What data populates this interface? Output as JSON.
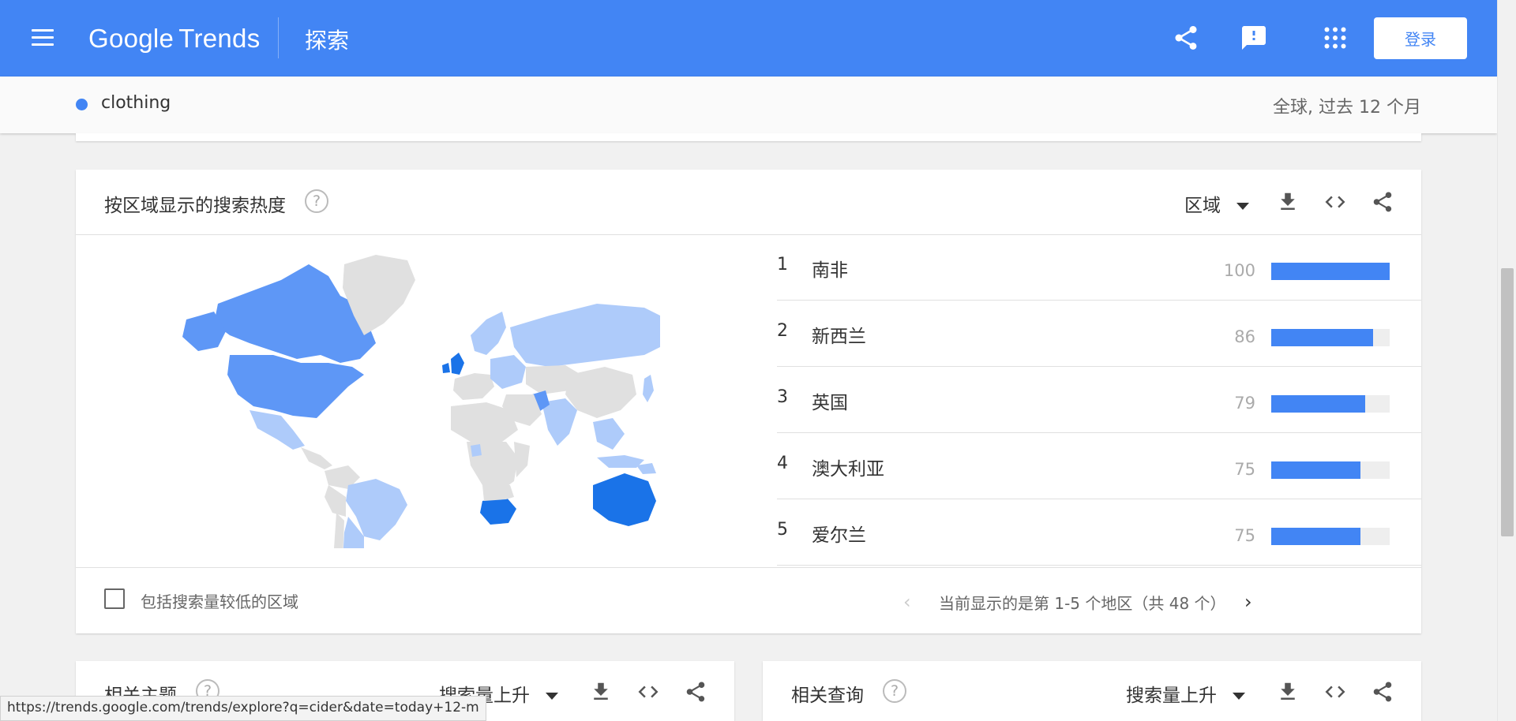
{
  "header": {
    "logo_google": "Google",
    "logo_trends": "Trends",
    "section": "探索",
    "login": "登录",
    "icons": [
      "menu-icon",
      "share-icon",
      "feedback-icon",
      "apps-icon"
    ]
  },
  "term": {
    "name": "clothing",
    "meta": "全球, 过去 12 个月",
    "color": "#4285f4"
  },
  "region_card": {
    "title": "按区域显示的搜索热度",
    "help": "?",
    "dropdown": "区域",
    "ranks": [
      {
        "rank": "1",
        "name": "南非",
        "value": "100",
        "fill": 100
      },
      {
        "rank": "2",
        "name": "新西兰",
        "value": "86",
        "fill": 86
      },
      {
        "rank": "3",
        "name": "英国",
        "value": "79",
        "fill": 79
      },
      {
        "rank": "4",
        "name": "澳大利亚",
        "value": "75",
        "fill": 75
      },
      {
        "rank": "5",
        "name": "爱尔兰",
        "value": "75",
        "fill": 75
      }
    ],
    "low_volume_label": "包括搜索量较低的区域",
    "pager_text": "当前显示的是第 1-5 个地区（共 48 个）",
    "pager_prev": "‹",
    "pager_next": "›"
  },
  "related_topics": {
    "title": "相关主题",
    "help": "?",
    "dropdown": "搜索量上升"
  },
  "related_queries": {
    "title": "相关查询",
    "help": "?",
    "dropdown": "搜索量上升"
  },
  "status_url": "https://trends.google.com/trends/explore?q=cider&date=today+12-m",
  "colors": {
    "primary": "#4285f4",
    "map_dark": "#1a73e8",
    "map_mid": "#5e97f6",
    "map_light": "#aecbfa",
    "map_none": "#e0e0e0"
  }
}
